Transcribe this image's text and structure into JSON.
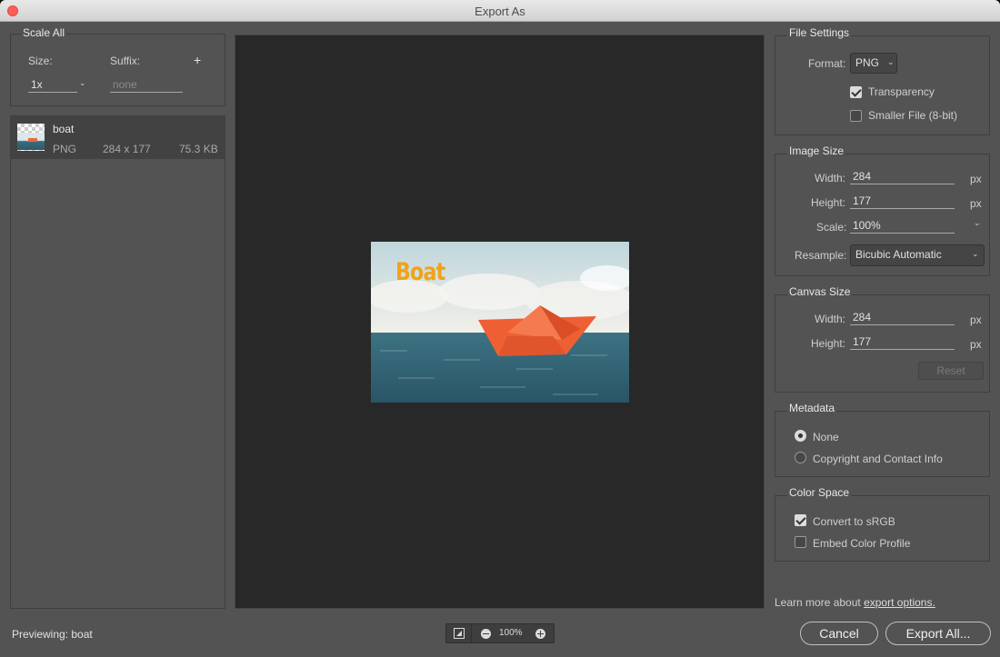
{
  "window": {
    "title": "Export As"
  },
  "scale_all": {
    "title": "Scale All",
    "size_label": "Size:",
    "suffix_label": "Suffix:",
    "add_label": "+",
    "size_value": "1x",
    "suffix_placeholder": "none"
  },
  "asset": {
    "name": "boat",
    "format": "PNG",
    "dimensions": "284 x 177",
    "filesize": "75.3 KB"
  },
  "preview": {
    "image_text": "Boat"
  },
  "file_settings": {
    "title": "File Settings",
    "format_label": "Format:",
    "format_value": "PNG",
    "transparency_label": "Transparency",
    "transparency_checked": true,
    "smaller_label": "Smaller File (8-bit)",
    "smaller_checked": false
  },
  "image_size": {
    "title": "Image Size",
    "width_label": "Width:",
    "width_value": "284",
    "height_label": "Height:",
    "height_value": "177",
    "scale_label": "Scale:",
    "scale_value": "100%",
    "resample_label": "Resample:",
    "resample_value": "Bicubic Automatic",
    "unit": "px"
  },
  "canvas_size": {
    "title": "Canvas Size",
    "width_label": "Width:",
    "width_value": "284",
    "height_label": "Height:",
    "height_value": "177",
    "unit": "px",
    "reset_label": "Reset"
  },
  "metadata": {
    "title": "Metadata",
    "options": [
      "None",
      "Copyright and Contact Info"
    ],
    "selected": "None"
  },
  "color_space": {
    "title": "Color Space",
    "convert_label": "Convert to sRGB",
    "convert_checked": true,
    "embed_label": "Embed Color Profile",
    "embed_checked": false
  },
  "footer": {
    "previewing_label": "Previewing:",
    "previewing_name": "boat",
    "zoom_value": "100%",
    "learn_more": "Learn more about",
    "export_options_link": "export options.",
    "cancel_label": "Cancel",
    "export_all_label": "Export All..."
  },
  "colors": {
    "panel": "#535353",
    "preview_bg": "#282828",
    "title_text": "#f0a31a",
    "boat": "#f0663a"
  }
}
